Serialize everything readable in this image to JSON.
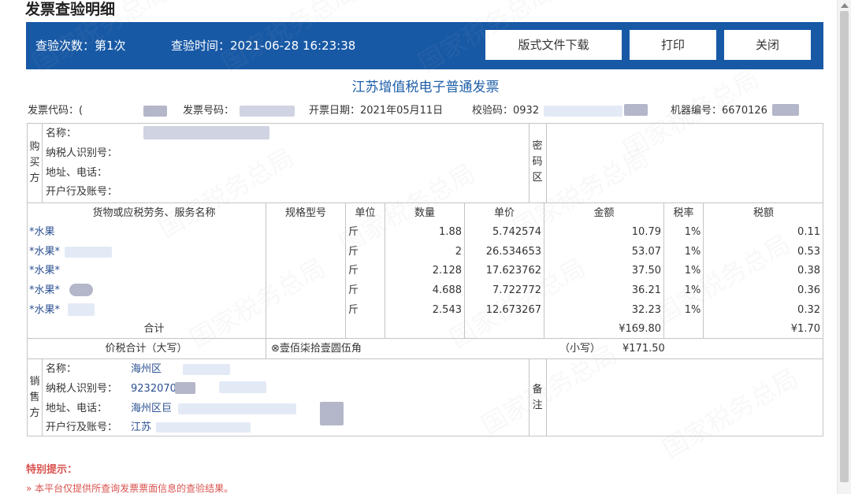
{
  "page": {
    "title": "发票查验明细"
  },
  "header": {
    "count_label": "查验次数：第1次",
    "time_label": "查验时间：2021-06-28 16:23:38",
    "download_button": "版式文件下载",
    "print_button": "打印",
    "close_button": "关闭"
  },
  "invoice": {
    "title": "江苏增值税电子普通发票",
    "code_label": "发票代码：(",
    "number_label": "发票号码：",
    "date_label": "开票日期：2021年05月11日",
    "check_label": "校验码：0932",
    "machine_label": "机器编号：6670126",
    "buyer": {
      "side_label": [
        "购",
        "买",
        "方"
      ],
      "name_label": "名称：",
      "tax_id_label": "纳税人识别号：",
      "address_label": "地址、电话：",
      "bank_label": "开户行及账号："
    },
    "password_area_label": [
      "密",
      "码",
      "区"
    ],
    "columns": [
      "货物或应税劳务、服务名称",
      "规格型号",
      "单位",
      "数量",
      "单价",
      "金额",
      "税率",
      "税额"
    ],
    "items": [
      {
        "name": "*水果",
        "unit": "斤",
        "qty": "1.88",
        "price": "5.742574",
        "amount": "10.79",
        "rate": "1%",
        "tax": "0.11"
      },
      {
        "name": "*水果*",
        "unit": "斤",
        "qty": "2",
        "price": "26.534653",
        "amount": "53.07",
        "rate": "1%",
        "tax": "0.53"
      },
      {
        "name": "*水果*",
        "unit": "斤",
        "qty": "2.128",
        "price": "17.623762",
        "amount": "37.50",
        "rate": "1%",
        "tax": "0.38"
      },
      {
        "name": "*水果*",
        "unit": "斤",
        "qty": "4.688",
        "price": "7.722772",
        "amount": "36.21",
        "rate": "1%",
        "tax": "0.36"
      },
      {
        "name": "*水果*",
        "unit": "斤",
        "qty": "2.543",
        "price": "12.673267",
        "amount": "32.23",
        "rate": "1%",
        "tax": "0.32"
      }
    ],
    "subtotal_label": "合计",
    "subtotal_amount": "¥169.80",
    "subtotal_tax": "¥1.70",
    "total_label": "价税合计（大写）",
    "total_upper": "⊗壹佰柒拾壹圆伍角",
    "total_lower_label": "（小写）",
    "total_lower": "¥171.50",
    "seller": {
      "side_label": [
        "销",
        "售",
        "方"
      ],
      "name_label": "名称：",
      "name_value": "海州区",
      "tax_id_label": "纳税人识别号：",
      "tax_id_value": "9232070",
      "address_label": "地址、电话：",
      "address_value": "海州区巨",
      "bank_label": "开户行及账号：",
      "bank_value": "江苏"
    },
    "remark_label": [
      "备",
      "注"
    ]
  },
  "tips": {
    "title": "特别提示：",
    "line1": "»  本平台仅提供所查询发票票面信息的查验结果。"
  },
  "watermark": "国家税务总局",
  "colors": {
    "header_bar": "#1859a6",
    "invoice_title": "#1f5fa8",
    "tip": "#d9534f"
  }
}
